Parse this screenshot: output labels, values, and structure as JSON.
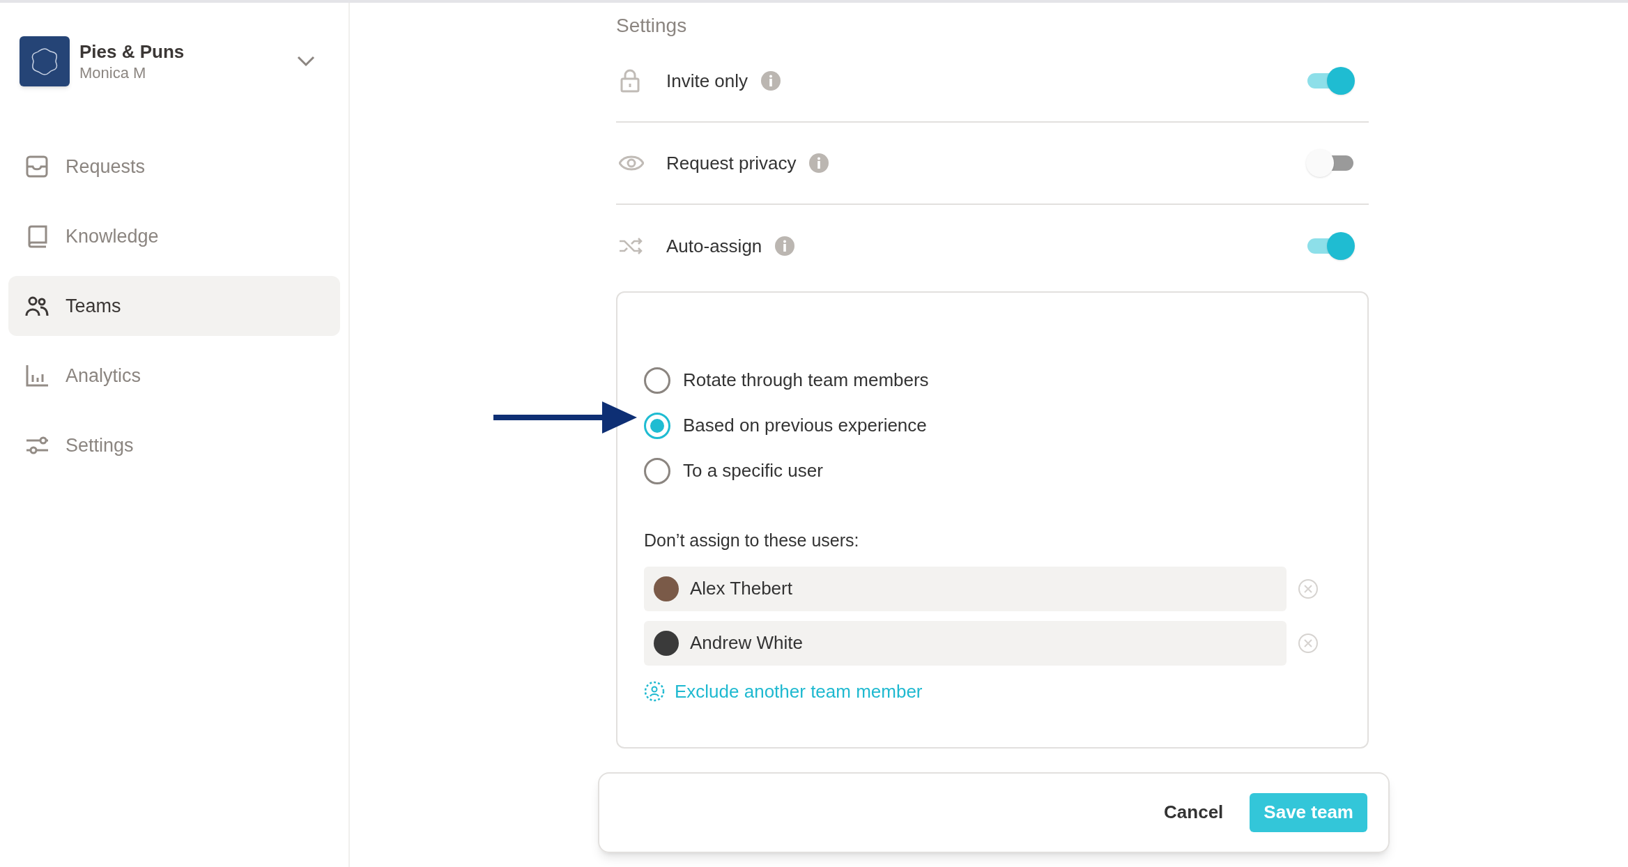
{
  "workspace": {
    "name": "Pies & Puns",
    "user": "Monica M"
  },
  "nav": [
    {
      "label": "Requests",
      "selected": false
    },
    {
      "label": "Knowledge",
      "selected": false
    },
    {
      "label": "Teams",
      "selected": true
    },
    {
      "label": "Analytics",
      "selected": false
    },
    {
      "label": "Settings",
      "selected": false
    }
  ],
  "settings": {
    "title": "Settings",
    "rows": [
      {
        "label": "Invite only",
        "on": true
      },
      {
        "label": "Request privacy",
        "on": false
      },
      {
        "label": "Auto-assign",
        "on": true
      }
    ]
  },
  "auto_assign": {
    "options": [
      {
        "label": "Rotate through team members",
        "selected": false
      },
      {
        "label": "Based on previous experience",
        "selected": true
      },
      {
        "label": "To a specific user",
        "selected": false
      }
    ],
    "exclude_label": "Don’t assign to these users:",
    "excluded_users": [
      {
        "name": "Alex Thebert"
      },
      {
        "name": "Andrew White"
      }
    ],
    "add_link": "Exclude another team member"
  },
  "footer": {
    "cancel": "Cancel",
    "save": "Save team"
  }
}
